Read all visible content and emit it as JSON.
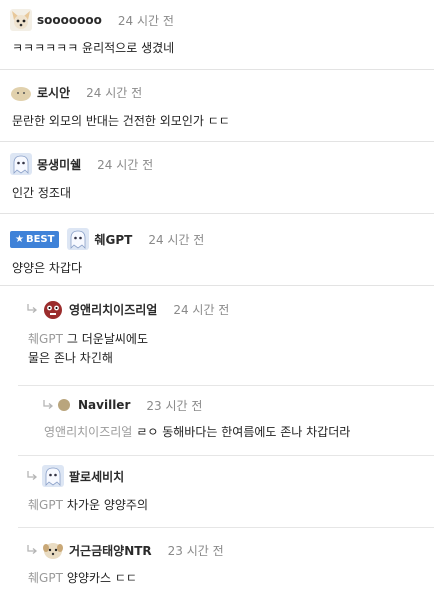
{
  "comments": [
    {
      "nick": "sooooooo",
      "time": "24 시간 전",
      "body": "ㅋㅋㅋㅋㅋㅋ 윤리적으로 생겼네",
      "avatar": "dog-face-icon"
    },
    {
      "nick": "로시안",
      "time": "24 시간 전",
      "body": "문란한 외모의 반대는 건전한 외모인가 ㄷㄷ",
      "avatar": "blob-icon"
    },
    {
      "nick": "몽생미쉘",
      "time": "24 시간 전",
      "body": "인간 정조대",
      "avatar": "ghost-icon"
    },
    {
      "badge": "BEST",
      "nick": "췌GPT",
      "time": "24 시간 전",
      "body": "양양은 차갑다",
      "avatar": "ghost-icon"
    },
    {
      "nick": "영앤리치이즈리얼",
      "time": "24 시간 전",
      "mention": "췌GPT",
      "body": "그 더운날씨에도",
      "body2": "물은 존나 차긴해",
      "avatar": "red-creature-icon"
    },
    {
      "nick": "Naviller",
      "time": "23 시간 전",
      "mention": "영앤리치이즈리얼",
      "body": "ㄹㅇ 동해바다는 한여름에도 존나 차갑더라",
      "avatar": "dot-icon"
    },
    {
      "nick": "팔로세비치",
      "time": "23 시간 전",
      "mention": "췌GPT",
      "body": "차가운 양양주의",
      "avatar": "ghost-icon"
    },
    {
      "nick": "거근금태양NTR",
      "time": "23 시간 전",
      "mention": "췌GPT",
      "body": "양양카스 ㄷㄷ",
      "avatar": "dog-face-icon"
    }
  ],
  "colors": {
    "best_badge": "#3f82d8",
    "nick": "#2a2a2a",
    "time": "#8a8a8a",
    "mention": "#9a9a9a",
    "divider": "#e3e3e3"
  }
}
